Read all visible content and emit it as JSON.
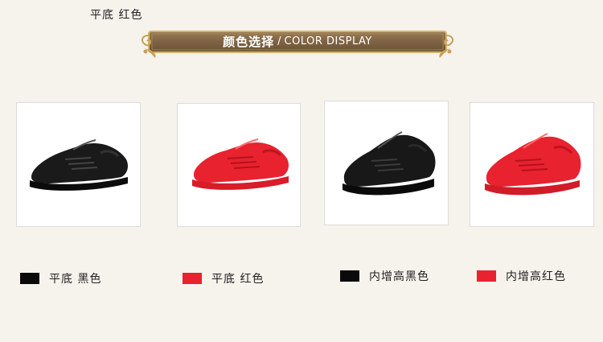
{
  "header_label": "平底 红色",
  "banner": {
    "title_cn": "颜色选择",
    "separator": "/",
    "title_en": "COLOR DISPLAY"
  },
  "colors": {
    "black": "#0c0c0c",
    "red": "#e8222f",
    "banner_brown": "#8a6e4c",
    "banner_gold": "#c9a05a"
  },
  "variants": [
    {
      "label": "平底 黑色",
      "swatch_color": "#0a0a0a",
      "shoe_color": "black"
    },
    {
      "label": "平底 红色",
      "swatch_color": "#e8222f",
      "shoe_color": "red"
    },
    {
      "label": "内增高黑色",
      "swatch_color": "#0a0a0a",
      "shoe_color": "black"
    },
    {
      "label": "内增高红色",
      "swatch_color": "#e8222f",
      "shoe_color": "red"
    }
  ]
}
